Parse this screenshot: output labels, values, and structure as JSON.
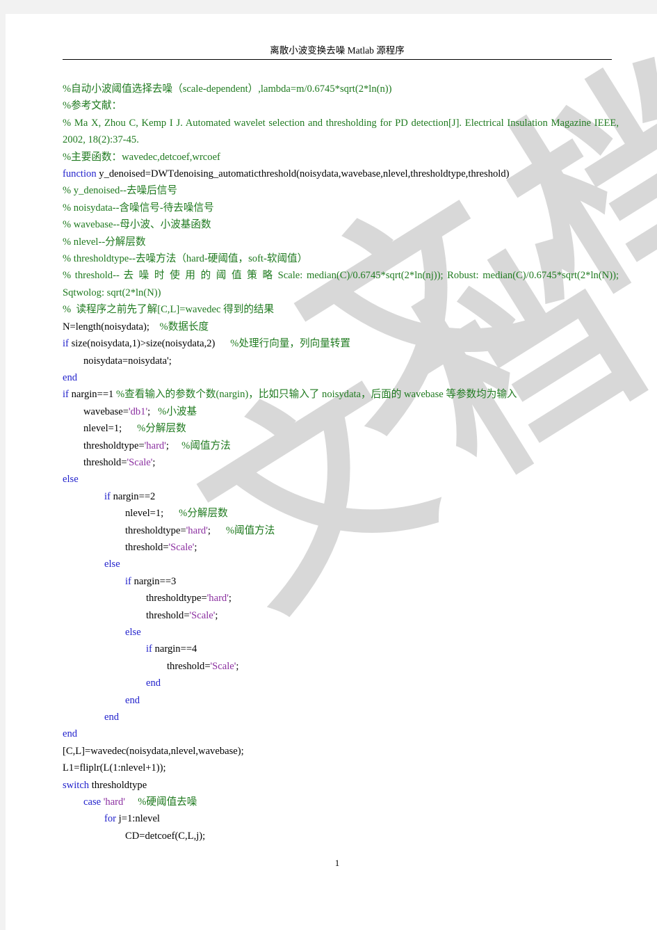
{
  "document": {
    "header_title": "离散小波变换去噪 Matlab 源程序",
    "page_number": "1",
    "watermark_text_1": "文档",
    "watermark_text_2": "文档"
  },
  "colors": {
    "comment": "#1f7a1f",
    "keyword": "#2222cc",
    "string": "#8b2fa0",
    "plain": "#000000",
    "page_background": "#ffffff",
    "canvas_background": "#f2f2f2",
    "watermark": "#d8d8d8"
  },
  "code": {
    "lines": [
      {
        "id": "l1",
        "indent": 0,
        "type": "comment",
        "text": "%自动小波阈值选择去噪（scale-dependent）,lambda=m/0.6745*sqrt(2*ln(n))"
      },
      {
        "id": "l2",
        "indent": 0,
        "type": "comment",
        "text": "%参考文献："
      },
      {
        "id": "l3",
        "indent": 0,
        "type": "comment-wrap",
        "text": "% Ma X, Zhou C, Kemp I J. Automated wavelet selection and thresholding for PD detection[J]. Electrical Insulation Magazine IEEE, 2002, 18(2):37-45."
      },
      {
        "id": "l4",
        "indent": 0,
        "type": "comment",
        "text": "%主要函数：wavedec,detcoef,wrcoef"
      },
      {
        "id": "l5",
        "indent": 0,
        "type": "mixed",
        "parts": [
          {
            "cls": "kw",
            "text": "function"
          },
          {
            "cls": "pl",
            "text": " y_denoised=DWTdenoising_automaticthreshold(noisydata,wavebase,nlevel,thresholdtype,threshold)"
          }
        ]
      },
      {
        "id": "l6",
        "indent": 0,
        "type": "comment",
        "text": "% y_denoised--去噪后信号"
      },
      {
        "id": "l7",
        "indent": 0,
        "type": "comment",
        "text": "% noisydata--含噪信号-待去噪信号"
      },
      {
        "id": "l8",
        "indent": 0,
        "type": "comment",
        "text": "% wavebase--母小波、小波基函数"
      },
      {
        "id": "l9",
        "indent": 0,
        "type": "comment",
        "text": "% nlevel--分解层数"
      },
      {
        "id": "l10",
        "indent": 0,
        "type": "comment",
        "text": "% thresholdtype--去噪方法（hard-硬阈值，soft-软阈值）"
      },
      {
        "id": "l11",
        "indent": 0,
        "type": "comment-wrap-cn",
        "text": "% threshold-- 去 噪 时 使 用 的 阈 值 策 略  Scale:  median(C)/0.6745*sqrt(2*ln(nj));  Robust: median(C)/0.6745*sqrt(2*ln(N));  Sqtwolog: sqrt(2*ln(N))"
      },
      {
        "id": "l12",
        "indent": 0,
        "type": "comment",
        "text": "%  读程序之前先了解[C,L]=wavedec 得到的结果"
      },
      {
        "id": "l13",
        "indent": 0,
        "type": "mixed",
        "parts": [
          {
            "cls": "pl",
            "text": "N=length(noisydata);    "
          },
          {
            "cls": "cm",
            "text": "%数据长度"
          }
        ]
      },
      {
        "id": "l14",
        "indent": 0,
        "type": "mixed",
        "parts": [
          {
            "cls": "kw",
            "text": "if"
          },
          {
            "cls": "pl",
            "text": " size(noisydata,1)>size(noisydata,2)      "
          },
          {
            "cls": "cm",
            "text": "%处理行向量，列向量转置"
          }
        ]
      },
      {
        "id": "l15",
        "indent": 1,
        "type": "mixed",
        "parts": [
          {
            "cls": "pl",
            "text": "noisydata=noisydata';"
          }
        ]
      },
      {
        "id": "l16",
        "indent": 0,
        "type": "mixed",
        "parts": [
          {
            "cls": "kw",
            "text": "end"
          }
        ]
      },
      {
        "id": "l17",
        "indent": 0,
        "type": "mixed-wrap",
        "parts": [
          {
            "cls": "kw",
            "text": "if"
          },
          {
            "cls": "pl",
            "text": " nargin==1      "
          },
          {
            "cls": "cm",
            "text": "%查看输入的参数个数(nargin)，比如只输入了 noisydata，后面的 wavebase 等参数均为输入"
          }
        ]
      },
      {
        "id": "l18",
        "indent": 1,
        "type": "mixed",
        "parts": [
          {
            "cls": "pl",
            "text": "wavebase="
          },
          {
            "cls": "str",
            "text": "'db1'"
          },
          {
            "cls": "pl",
            "text": ";   "
          },
          {
            "cls": "cm",
            "text": "%小波基"
          }
        ]
      },
      {
        "id": "l19",
        "indent": 1,
        "type": "mixed",
        "parts": [
          {
            "cls": "pl",
            "text": "nlevel=1;      "
          },
          {
            "cls": "cm",
            "text": "%分解层数"
          }
        ]
      },
      {
        "id": "l20",
        "indent": 1,
        "type": "mixed",
        "parts": [
          {
            "cls": "pl",
            "text": "thresholdtype="
          },
          {
            "cls": "str",
            "text": "'hard'"
          },
          {
            "cls": "pl",
            "text": ";     "
          },
          {
            "cls": "cm",
            "text": "%阈值方法"
          }
        ]
      },
      {
        "id": "l21",
        "indent": 1,
        "type": "mixed",
        "parts": [
          {
            "cls": "pl",
            "text": "threshold="
          },
          {
            "cls": "str",
            "text": "'Scale'"
          },
          {
            "cls": "pl",
            "text": ";"
          }
        ]
      },
      {
        "id": "l22",
        "indent": 0,
        "type": "mixed",
        "parts": [
          {
            "cls": "kw",
            "text": "else"
          }
        ]
      },
      {
        "id": "l23",
        "indent": 2,
        "type": "mixed",
        "parts": [
          {
            "cls": "kw",
            "text": "if"
          },
          {
            "cls": "pl",
            "text": " nargin==2"
          }
        ]
      },
      {
        "id": "l24",
        "indent": 3,
        "type": "mixed",
        "parts": [
          {
            "cls": "pl",
            "text": "nlevel=1;      "
          },
          {
            "cls": "cm",
            "text": "%分解层数"
          }
        ]
      },
      {
        "id": "l25",
        "indent": 3,
        "type": "mixed",
        "parts": [
          {
            "cls": "pl",
            "text": "thresholdtype="
          },
          {
            "cls": "str",
            "text": "'hard'"
          },
          {
            "cls": "pl",
            "text": ";      "
          },
          {
            "cls": "cm",
            "text": "%阈值方法"
          }
        ]
      },
      {
        "id": "l26",
        "indent": 3,
        "type": "mixed",
        "parts": [
          {
            "cls": "pl",
            "text": "threshold="
          },
          {
            "cls": "str",
            "text": "'Scale'"
          },
          {
            "cls": "pl",
            "text": ";"
          }
        ]
      },
      {
        "id": "l27",
        "indent": 2,
        "type": "mixed",
        "parts": [
          {
            "cls": "kw",
            "text": "else"
          }
        ]
      },
      {
        "id": "l28",
        "indent": 3,
        "type": "mixed",
        "parts": [
          {
            "cls": "kw",
            "text": "if"
          },
          {
            "cls": "pl",
            "text": " nargin==3"
          }
        ]
      },
      {
        "id": "l29",
        "indent": 4,
        "type": "mixed",
        "parts": [
          {
            "cls": "pl",
            "text": "thresholdtype="
          },
          {
            "cls": "str",
            "text": "'hard'"
          },
          {
            "cls": "pl",
            "text": ";"
          }
        ]
      },
      {
        "id": "l30",
        "indent": 4,
        "type": "mixed",
        "parts": [
          {
            "cls": "pl",
            "text": "threshold="
          },
          {
            "cls": "str",
            "text": "'Scale'"
          },
          {
            "cls": "pl",
            "text": ";"
          }
        ]
      },
      {
        "id": "l31",
        "indent": 3,
        "type": "mixed",
        "parts": [
          {
            "cls": "kw",
            "text": "else"
          }
        ]
      },
      {
        "id": "l32",
        "indent": 4,
        "type": "mixed",
        "parts": [
          {
            "cls": "kw",
            "text": "if"
          },
          {
            "cls": "pl",
            "text": " nargin==4"
          }
        ]
      },
      {
        "id": "l33",
        "indent": 5,
        "type": "mixed",
        "parts": [
          {
            "cls": "pl",
            "text": "threshold="
          },
          {
            "cls": "str",
            "text": "'Scale'"
          },
          {
            "cls": "pl",
            "text": ";"
          }
        ]
      },
      {
        "id": "l34",
        "indent": 4,
        "type": "mixed",
        "parts": [
          {
            "cls": "kw",
            "text": "end"
          }
        ]
      },
      {
        "id": "l35",
        "indent": 3,
        "type": "mixed",
        "parts": [
          {
            "cls": "kw",
            "text": "end"
          }
        ]
      },
      {
        "id": "l36",
        "indent": 2,
        "type": "mixed",
        "parts": [
          {
            "cls": "kw",
            "text": "end"
          }
        ]
      },
      {
        "id": "l37",
        "indent": 0,
        "type": "mixed",
        "parts": [
          {
            "cls": "kw",
            "text": "end"
          }
        ]
      },
      {
        "id": "l38",
        "indent": 0,
        "type": "mixed",
        "parts": [
          {
            "cls": "pl",
            "text": "[C,L]=wavedec(noisydata,nlevel,wavebase);"
          }
        ]
      },
      {
        "id": "l39",
        "indent": 0,
        "type": "mixed",
        "parts": [
          {
            "cls": "pl",
            "text": "L1=fliplr(L(1:nlevel+1));"
          }
        ]
      },
      {
        "id": "l40",
        "indent": 0,
        "type": "mixed",
        "parts": [
          {
            "cls": "kw",
            "text": "switch"
          },
          {
            "cls": "pl",
            "text": " thresholdtype"
          }
        ]
      },
      {
        "id": "l41",
        "indent": 1,
        "type": "mixed",
        "parts": [
          {
            "cls": "kw",
            "text": "case"
          },
          {
            "cls": "pl",
            "text": " "
          },
          {
            "cls": "str",
            "text": "'hard'"
          },
          {
            "cls": "pl",
            "text": "     "
          },
          {
            "cls": "cm",
            "text": "%硬阈值去噪"
          }
        ]
      },
      {
        "id": "l42",
        "indent": 2,
        "type": "mixed",
        "parts": [
          {
            "cls": "kw",
            "text": "for"
          },
          {
            "cls": "pl",
            "text": " j=1:nlevel"
          }
        ]
      },
      {
        "id": "l43",
        "indent": 3,
        "type": "mixed",
        "parts": [
          {
            "cls": "pl",
            "text": "CD=detcoef(C,L,j);"
          }
        ]
      }
    ]
  }
}
